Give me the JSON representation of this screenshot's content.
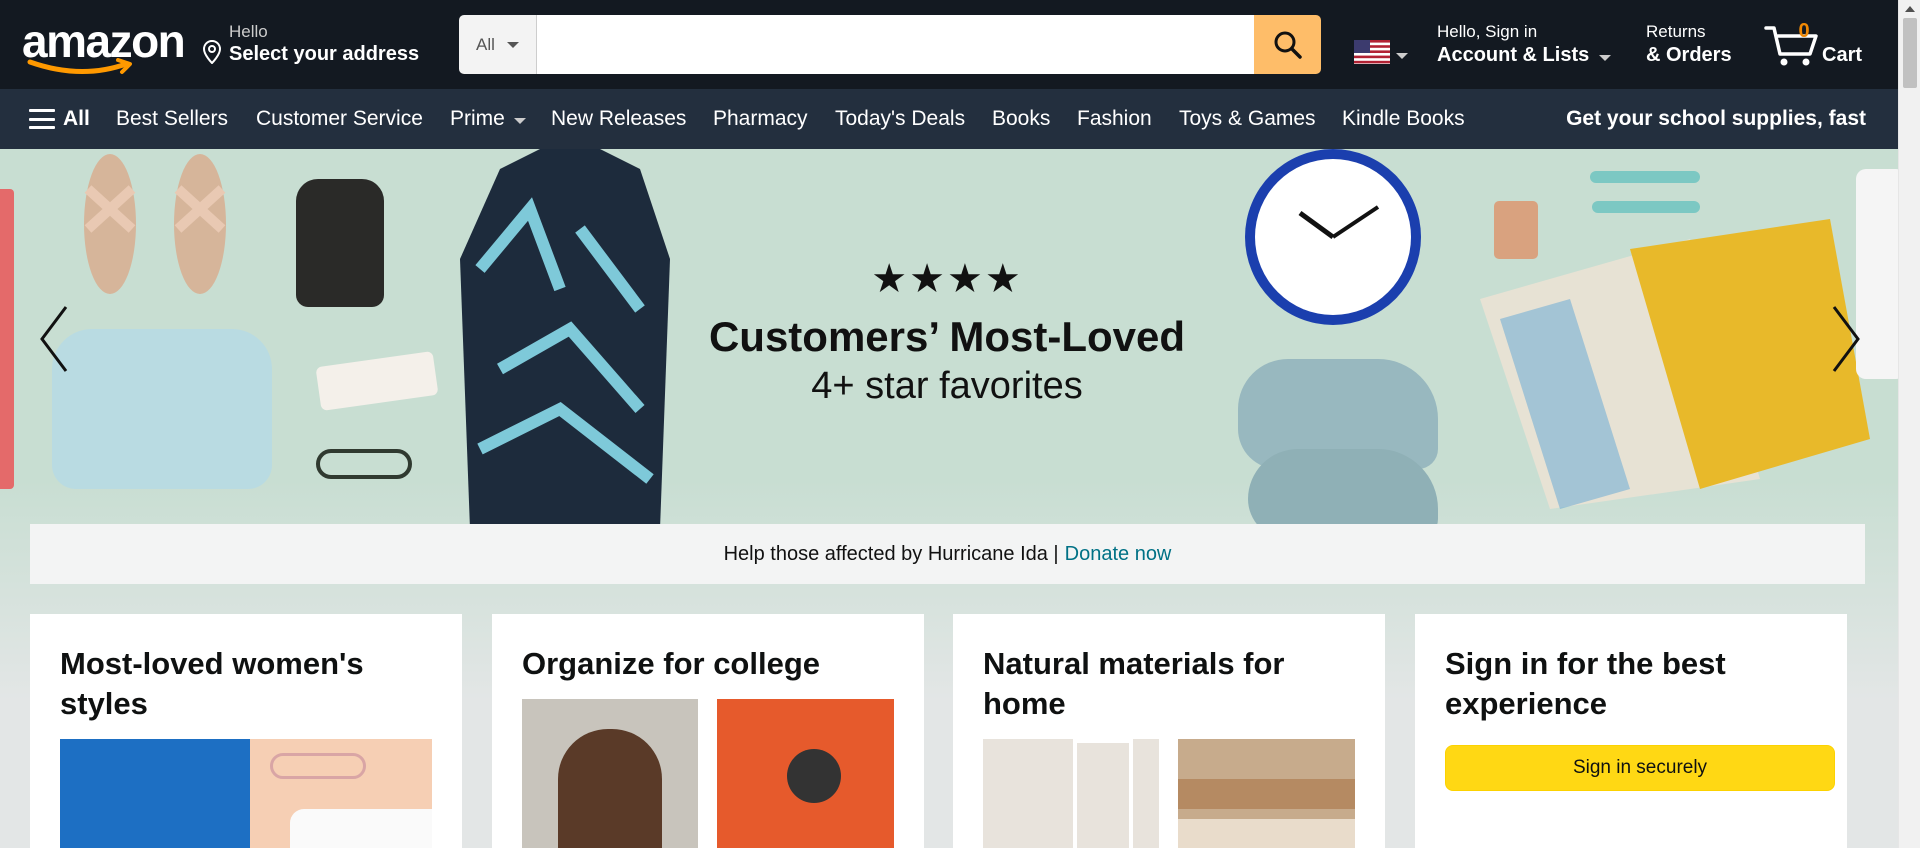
{
  "header": {
    "logo": "amazon",
    "address_hello": "Hello",
    "address_label": "Select your address",
    "search_category": "All",
    "search_placeholder": "",
    "account_hello": "Hello, Sign in",
    "account_label": "Account & Lists",
    "returns": "Returns",
    "orders": "& Orders",
    "cart_count": "0",
    "cart_label": "Cart"
  },
  "subnav": {
    "all_label": "All",
    "items": [
      "Best Sellers",
      "Customer Service",
      "Prime",
      "New Releases",
      "Pharmacy",
      "Today's Deals",
      "Books",
      "Fashion",
      "Toys & Games",
      "Kindle Books"
    ],
    "promo": "Get your school supplies, fast"
  },
  "hero": {
    "stars": "★★★★",
    "title": "Customers’ Most-Loved",
    "subtitle": "4+ star favorites"
  },
  "notice": {
    "text": "Help those affected by Hurricane Ida |",
    "link": "Donate now"
  },
  "cards": [
    {
      "title": "Most-loved women's styles"
    },
    {
      "title": "Organize for college"
    },
    {
      "title": "Natural materials for home"
    },
    {
      "title": "Sign in for the best experience",
      "button": "Sign in securely"
    }
  ],
  "colors": {
    "topbar": "#131921",
    "subnav": "#232f3e",
    "search_button": "#febd69",
    "cart_count": "#f08804",
    "link": "#007185",
    "signin_button": "#ffd814"
  }
}
